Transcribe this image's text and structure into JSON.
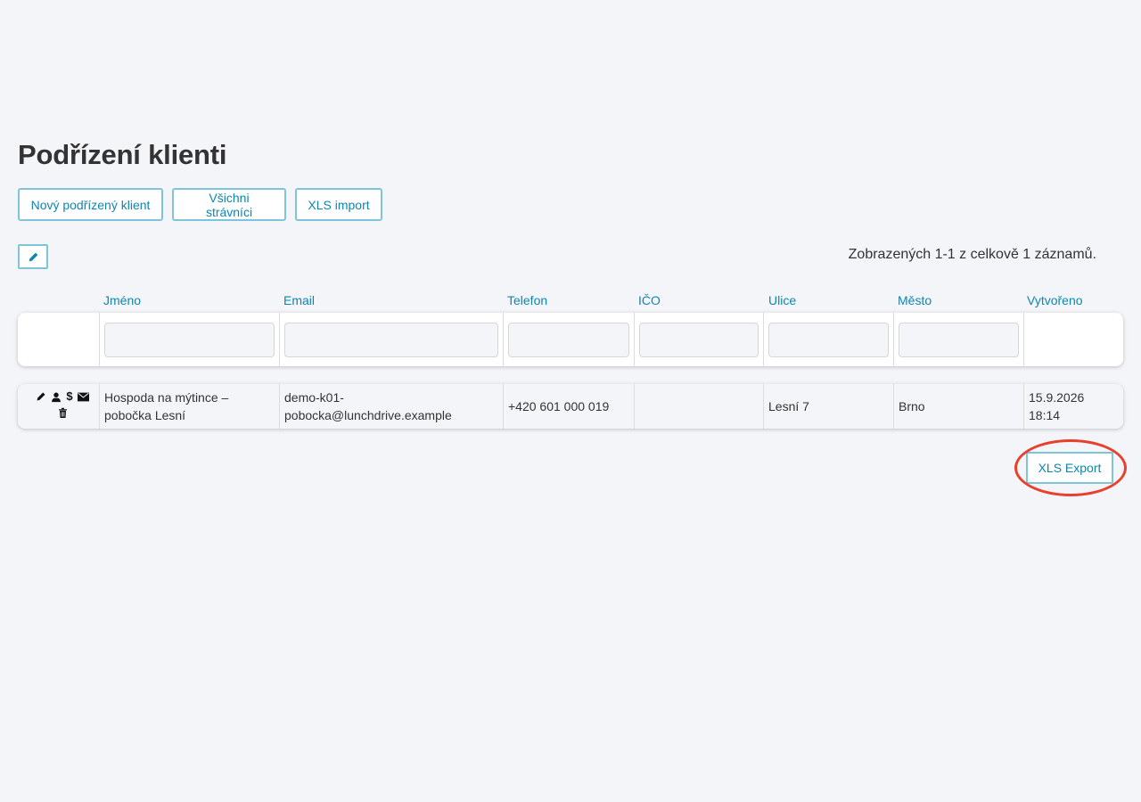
{
  "page": {
    "title": "Podřízení klienti"
  },
  "toolbar": {
    "new_client": "Nový podřízený klient",
    "all_diners": "Všichni strávníci",
    "xls_import": "XLS import"
  },
  "summary": "Zobrazených 1-1 z celkově 1 záznamů.",
  "table": {
    "columns": [
      "Jméno",
      "Email",
      "Telefon",
      "IČO",
      "Ulice",
      "Město",
      "Vytvořeno"
    ],
    "rows": [
      {
        "name_line1": "Hospoda na mýtince –",
        "name_line2": "pobočka Lesní",
        "email_line1": "demo-k01-",
        "email_line2": "pobocka@lunchdrive.example",
        "phone": "+420 601 000 019",
        "ico": "",
        "street": "Lesní 7",
        "city": "Brno",
        "created_date": "15.9.2026",
        "created_time": "18:14",
        "actions": [
          "pencil-icon",
          "user-icon",
          "dollar-icon",
          "envelope-icon",
          "trash-icon"
        ],
        "dollar_glyph": "$"
      }
    ]
  },
  "export": {
    "label": "XLS Export"
  },
  "colors": {
    "accent": "#0f86ad",
    "button_border": "#7fc4d8",
    "highlight": "#e8402c",
    "background": "#f4f5f9"
  }
}
